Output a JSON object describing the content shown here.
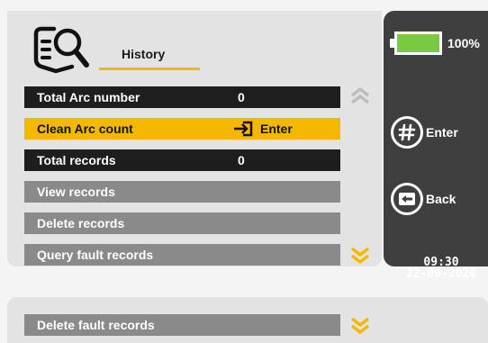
{
  "header": {
    "title": "History"
  },
  "rows": [
    {
      "label": "Total Arc number",
      "value": "0"
    },
    {
      "label": "Clean Arc count",
      "action_label": "Enter"
    },
    {
      "label": "Total records",
      "value": "0"
    },
    {
      "label": "View records"
    },
    {
      "label": "Delete records"
    },
    {
      "label": "Query fault records"
    }
  ],
  "lower_rows": [
    {
      "label": "Delete fault records"
    }
  ],
  "side": {
    "battery_percent": "100%",
    "battery_level": 1.0,
    "enter_label": "Enter",
    "back_label": "Back",
    "time": "09:30",
    "date": "22-09-2020"
  },
  "icons": {
    "header": "history-document-search-icon",
    "scroll_up": "double-chevron-up-icon",
    "scroll_down": "double-chevron-down-icon",
    "enter_action": "enter-arrow-icon",
    "enter_button": "hash-enter-icon",
    "back_button": "back-arrow-icon"
  },
  "colors": {
    "accent": "#f5b800",
    "dark_row": "#1e1e1e",
    "gray_row": "#8a8a8a",
    "side_panel": "#3f3f3f",
    "battery_fill": "#7ac943"
  }
}
